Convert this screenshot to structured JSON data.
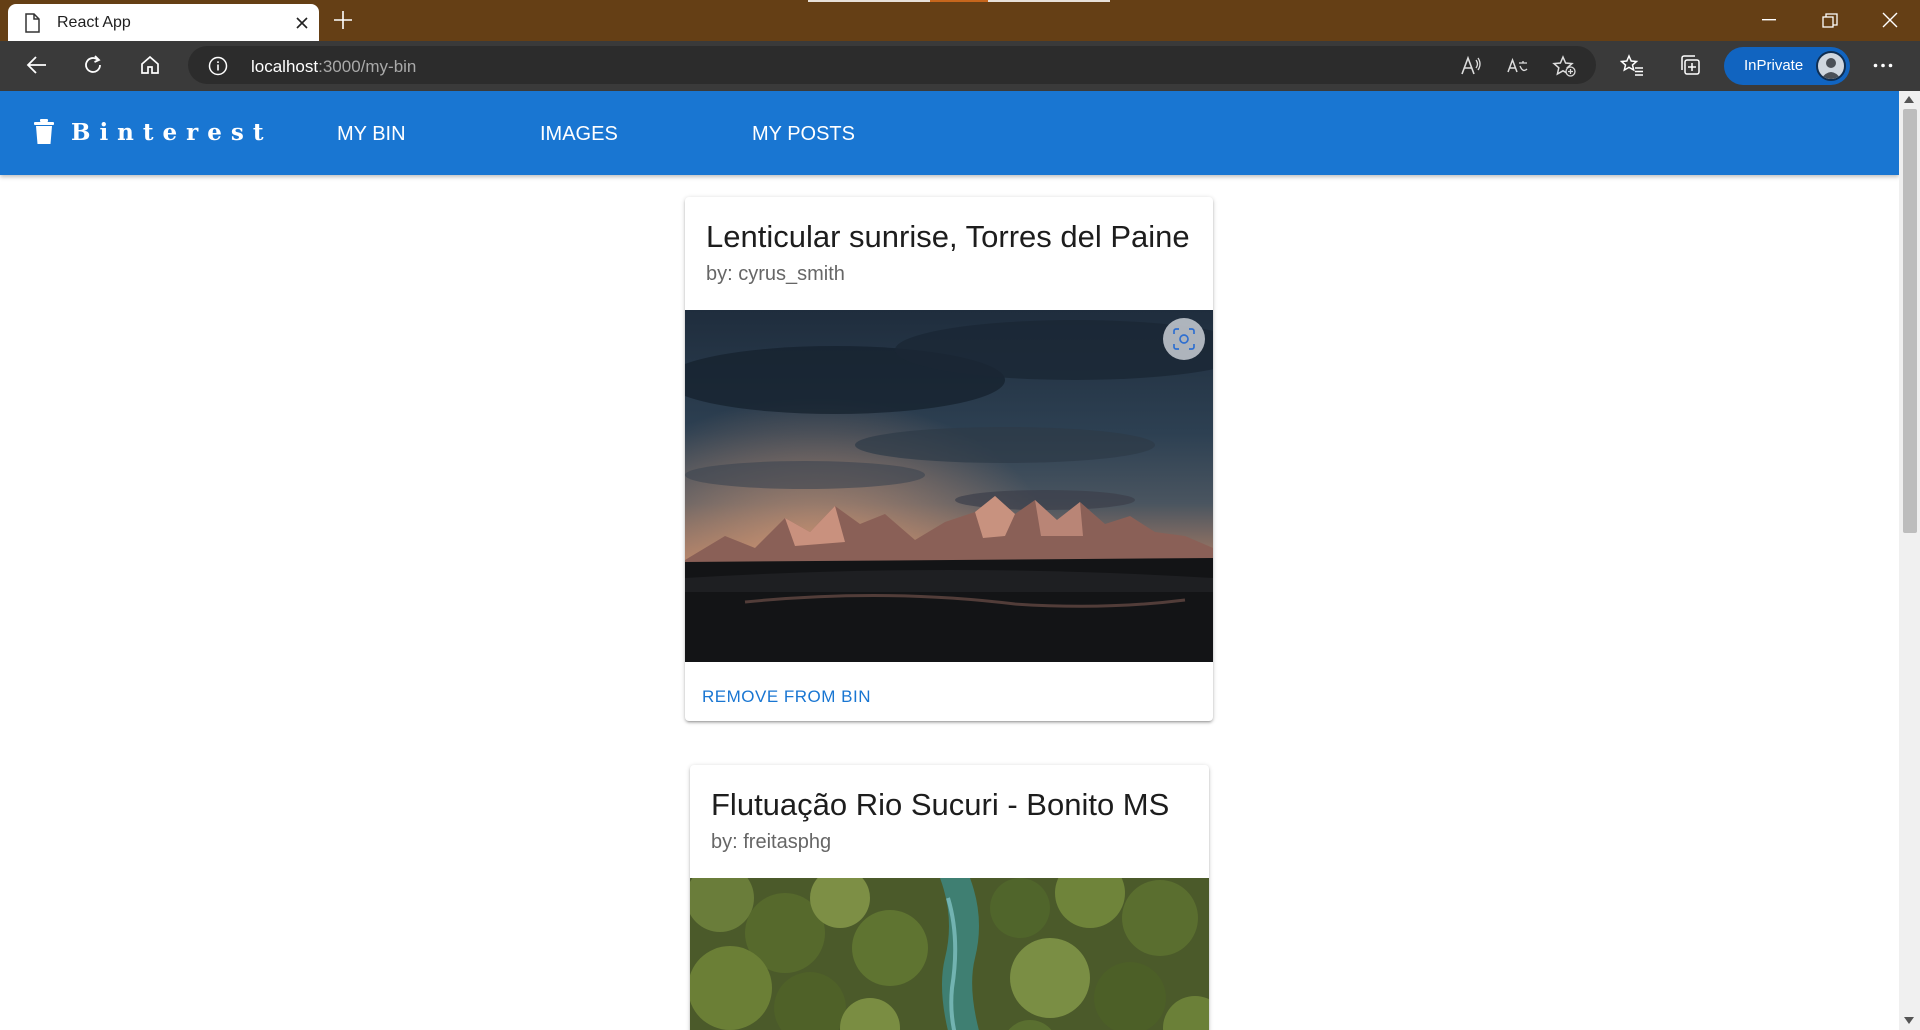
{
  "browser": {
    "tab_title": "React App",
    "url_host": "localhost",
    "url_path": ":3000/my-bin",
    "inprivate_label": "InPrivate"
  },
  "app": {
    "brand": "Binterest",
    "nav": [
      "MY BIN",
      "IMAGES",
      "MY POSTS"
    ],
    "colors": {
      "primary": "#1976d2"
    }
  },
  "posts": [
    {
      "title": "Lenticular sunrise, Torres del Paine",
      "author": "by: cyrus_smith",
      "action": "REMOVE FROM BIN"
    },
    {
      "title": "Flutuação Rio Sucuri - Bonito MS",
      "author": "by: freitasphg"
    }
  ]
}
